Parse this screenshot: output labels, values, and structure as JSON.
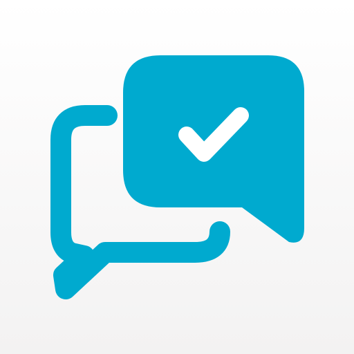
{
  "icon": {
    "name": "chat-bubbles-check-icon",
    "accent_color": "#00AACF",
    "background_top": "#FFFFFF",
    "background_bottom": "#F3F2F2",
    "check_color": "#FFFFFF"
  }
}
